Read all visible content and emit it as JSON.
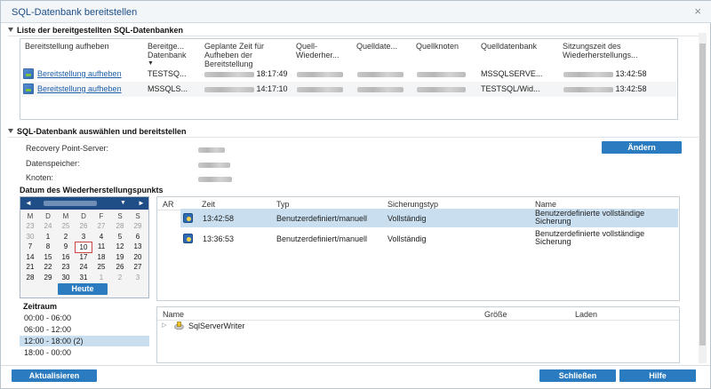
{
  "window": {
    "title": "SQL-Datenbank bereitstellen",
    "close_glyph": "×"
  },
  "section1": {
    "title": "Liste der bereitgestellten SQL-Datenbanken",
    "columns": [
      "Bereitstellung aufheben",
      "Bereitge... Datenbank",
      "Geplante Zeit für Aufheben der Bereitstellung",
      "Quell-Wiederher...",
      "Quelldate...",
      "Quellknoten",
      "Quelldatenbank",
      "Sitzungszeit des Wiederherstellungs..."
    ],
    "rows": [
      {
        "action": "Bereitstellung aufheben",
        "db": "TESTSQ...",
        "time": "18:17:49",
        "source_db": "MSSQLSERVE...",
        "session_time": "13:42:58"
      },
      {
        "action": "Bereitstellung aufheben",
        "db": "MSSQLS...",
        "time": "14:17:10",
        "source_db": "TESTSQL/Wid...",
        "session_time": "13:42:58"
      }
    ]
  },
  "section2": {
    "title": "SQL-Datenbank auswählen und bereitstellen",
    "fields": [
      {
        "label": "Recovery Point-Server:"
      },
      {
        "label": "Datenspeicher:"
      },
      {
        "label": "Knoten:"
      }
    ],
    "change_button": "Ändern",
    "restore_date_label": "Datum des Wiederherstellungspunkts"
  },
  "calendar": {
    "prev": "◄",
    "next": "►",
    "month_dropdown": "▼",
    "weekdays": [
      "M",
      "D",
      "M",
      "D",
      "F",
      "S",
      "S"
    ],
    "weeks": [
      [
        {
          "d": "23",
          "o": true
        },
        {
          "d": "24",
          "o": true
        },
        {
          "d": "25",
          "o": true
        },
        {
          "d": "26",
          "o": true
        },
        {
          "d": "27",
          "o": true
        },
        {
          "d": "28",
          "o": true
        },
        {
          "d": "29",
          "o": true
        }
      ],
      [
        {
          "d": "30",
          "o": true
        },
        {
          "d": "1"
        },
        {
          "d": "2"
        },
        {
          "d": "3"
        },
        {
          "d": "4"
        },
        {
          "d": "5"
        },
        {
          "d": "6"
        }
      ],
      [
        {
          "d": "7"
        },
        {
          "d": "8"
        },
        {
          "d": "9"
        },
        {
          "d": "10",
          "today": true
        },
        {
          "d": "11"
        },
        {
          "d": "12"
        },
        {
          "d": "13"
        }
      ],
      [
        {
          "d": "14"
        },
        {
          "d": "15"
        },
        {
          "d": "16"
        },
        {
          "d": "17"
        },
        {
          "d": "18"
        },
        {
          "d": "19"
        },
        {
          "d": "20"
        }
      ],
      [
        {
          "d": "21"
        },
        {
          "d": "22"
        },
        {
          "d": "23"
        },
        {
          "d": "24"
        },
        {
          "d": "25"
        },
        {
          "d": "26"
        },
        {
          "d": "27"
        }
      ],
      [
        {
          "d": "28"
        },
        {
          "d": "29"
        },
        {
          "d": "30"
        },
        {
          "d": "31"
        },
        {
          "d": "1",
          "o": true
        },
        {
          "d": "2",
          "o": true
        },
        {
          "d": "3",
          "o": true
        }
      ]
    ],
    "today_button": "Heute"
  },
  "time_range": {
    "title": "Zeitraum",
    "items": [
      {
        "label": "00:00 - 06:00"
      },
      {
        "label": "06:00 - 12:00"
      },
      {
        "label": "12:00 - 18:00   (2)",
        "selected": true
      },
      {
        "label": "18:00 - 00:00"
      }
    ]
  },
  "recovery_points": {
    "columns": [
      "AR",
      "Zeit",
      "Typ",
      "Sicherungstyp",
      "Name"
    ],
    "rows": [
      {
        "time": "13:42:58",
        "type": "Benutzerdefiniert/manuell",
        "backup_type": "Vollständig",
        "name": "Benutzerdefinierte vollständige Sicherung",
        "selected": true
      },
      {
        "time": "13:36:53",
        "type": "Benutzerdefiniert/manuell",
        "backup_type": "Vollständig",
        "name": "Benutzerdefinierte vollständige Sicherung"
      }
    ]
  },
  "tree": {
    "columns": [
      "Name",
      "Größe",
      "Laden"
    ],
    "items": [
      {
        "expander": "▷",
        "label": "SqlServerWriter"
      }
    ]
  },
  "footer": {
    "refresh": "Aktualisieren",
    "close": "Schließen",
    "help": "Hilfe"
  }
}
